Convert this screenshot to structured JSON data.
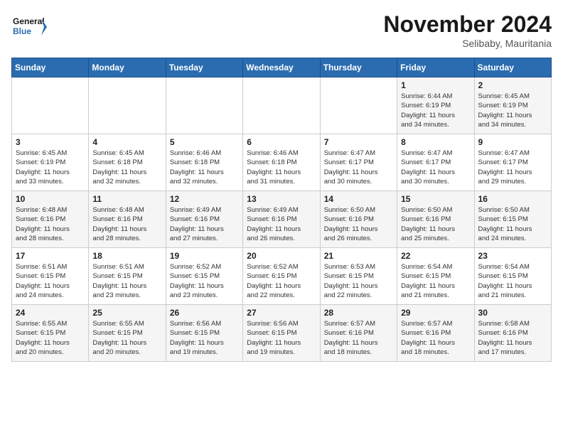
{
  "logo": {
    "line1": "General",
    "line2": "Blue"
  },
  "title": "November 2024",
  "subtitle": "Selibaby, Mauritania",
  "weekdays": [
    "Sunday",
    "Monday",
    "Tuesday",
    "Wednesday",
    "Thursday",
    "Friday",
    "Saturday"
  ],
  "weeks": [
    [
      {
        "day": "",
        "info": ""
      },
      {
        "day": "",
        "info": ""
      },
      {
        "day": "",
        "info": ""
      },
      {
        "day": "",
        "info": ""
      },
      {
        "day": "",
        "info": ""
      },
      {
        "day": "1",
        "info": "Sunrise: 6:44 AM\nSunset: 6:19 PM\nDaylight: 11 hours\nand 34 minutes."
      },
      {
        "day": "2",
        "info": "Sunrise: 6:45 AM\nSunset: 6:19 PM\nDaylight: 11 hours\nand 34 minutes."
      }
    ],
    [
      {
        "day": "3",
        "info": "Sunrise: 6:45 AM\nSunset: 6:19 PM\nDaylight: 11 hours\nand 33 minutes."
      },
      {
        "day": "4",
        "info": "Sunrise: 6:45 AM\nSunset: 6:18 PM\nDaylight: 11 hours\nand 32 minutes."
      },
      {
        "day": "5",
        "info": "Sunrise: 6:46 AM\nSunset: 6:18 PM\nDaylight: 11 hours\nand 32 minutes."
      },
      {
        "day": "6",
        "info": "Sunrise: 6:46 AM\nSunset: 6:18 PM\nDaylight: 11 hours\nand 31 minutes."
      },
      {
        "day": "7",
        "info": "Sunrise: 6:47 AM\nSunset: 6:17 PM\nDaylight: 11 hours\nand 30 minutes."
      },
      {
        "day": "8",
        "info": "Sunrise: 6:47 AM\nSunset: 6:17 PM\nDaylight: 11 hours\nand 30 minutes."
      },
      {
        "day": "9",
        "info": "Sunrise: 6:47 AM\nSunset: 6:17 PM\nDaylight: 11 hours\nand 29 minutes."
      }
    ],
    [
      {
        "day": "10",
        "info": "Sunrise: 6:48 AM\nSunset: 6:16 PM\nDaylight: 11 hours\nand 28 minutes."
      },
      {
        "day": "11",
        "info": "Sunrise: 6:48 AM\nSunset: 6:16 PM\nDaylight: 11 hours\nand 28 minutes."
      },
      {
        "day": "12",
        "info": "Sunrise: 6:49 AM\nSunset: 6:16 PM\nDaylight: 11 hours\nand 27 minutes."
      },
      {
        "day": "13",
        "info": "Sunrise: 6:49 AM\nSunset: 6:16 PM\nDaylight: 11 hours\nand 26 minutes."
      },
      {
        "day": "14",
        "info": "Sunrise: 6:50 AM\nSunset: 6:16 PM\nDaylight: 11 hours\nand 26 minutes."
      },
      {
        "day": "15",
        "info": "Sunrise: 6:50 AM\nSunset: 6:16 PM\nDaylight: 11 hours\nand 25 minutes."
      },
      {
        "day": "16",
        "info": "Sunrise: 6:50 AM\nSunset: 6:15 PM\nDaylight: 11 hours\nand 24 minutes."
      }
    ],
    [
      {
        "day": "17",
        "info": "Sunrise: 6:51 AM\nSunset: 6:15 PM\nDaylight: 11 hours\nand 24 minutes."
      },
      {
        "day": "18",
        "info": "Sunrise: 6:51 AM\nSunset: 6:15 PM\nDaylight: 11 hours\nand 23 minutes."
      },
      {
        "day": "19",
        "info": "Sunrise: 6:52 AM\nSunset: 6:15 PM\nDaylight: 11 hours\nand 23 minutes."
      },
      {
        "day": "20",
        "info": "Sunrise: 6:52 AM\nSunset: 6:15 PM\nDaylight: 11 hours\nand 22 minutes."
      },
      {
        "day": "21",
        "info": "Sunrise: 6:53 AM\nSunset: 6:15 PM\nDaylight: 11 hours\nand 22 minutes."
      },
      {
        "day": "22",
        "info": "Sunrise: 6:54 AM\nSunset: 6:15 PM\nDaylight: 11 hours\nand 21 minutes."
      },
      {
        "day": "23",
        "info": "Sunrise: 6:54 AM\nSunset: 6:15 PM\nDaylight: 11 hours\nand 21 minutes."
      }
    ],
    [
      {
        "day": "24",
        "info": "Sunrise: 6:55 AM\nSunset: 6:15 PM\nDaylight: 11 hours\nand 20 minutes."
      },
      {
        "day": "25",
        "info": "Sunrise: 6:55 AM\nSunset: 6:15 PM\nDaylight: 11 hours\nand 20 minutes."
      },
      {
        "day": "26",
        "info": "Sunrise: 6:56 AM\nSunset: 6:15 PM\nDaylight: 11 hours\nand 19 minutes."
      },
      {
        "day": "27",
        "info": "Sunrise: 6:56 AM\nSunset: 6:15 PM\nDaylight: 11 hours\nand 19 minutes."
      },
      {
        "day": "28",
        "info": "Sunrise: 6:57 AM\nSunset: 6:16 PM\nDaylight: 11 hours\nand 18 minutes."
      },
      {
        "day": "29",
        "info": "Sunrise: 6:57 AM\nSunset: 6:16 PM\nDaylight: 11 hours\nand 18 minutes."
      },
      {
        "day": "30",
        "info": "Sunrise: 6:58 AM\nSunset: 6:16 PM\nDaylight: 11 hours\nand 17 minutes."
      }
    ]
  ]
}
